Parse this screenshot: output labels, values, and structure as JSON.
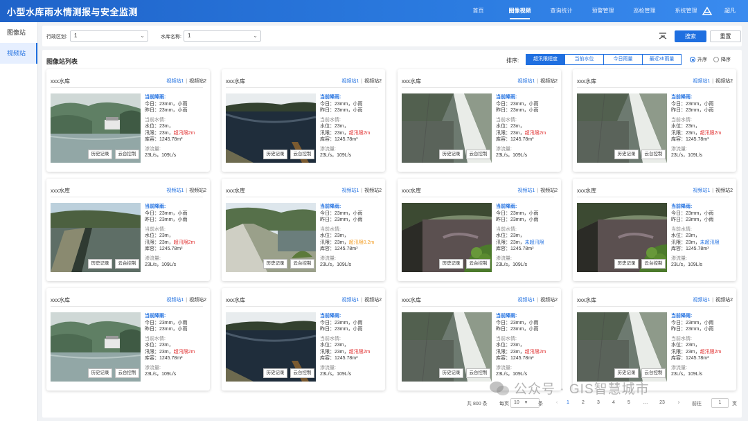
{
  "header": {
    "title": "小型水库雨水情测报与安全监测",
    "nav": [
      "首页",
      "图像视频",
      "查询统计",
      "预警管理",
      "巡检管理",
      "系统管理"
    ],
    "active_nav": 1,
    "user": "超凡",
    "colors": {
      "primary": "#1f6fe0",
      "header": "#2b7be0",
      "danger": "#e02c2c",
      "warning": "#f39b1e"
    }
  },
  "sidebar": {
    "items": [
      "图像站",
      "视频站"
    ],
    "active": 1
  },
  "filter": {
    "region_label": "行政区划:",
    "region_value": "1",
    "reservoir_label": "水库名称:",
    "reservoir_value": "1",
    "search_label": "搜索",
    "reset_label": "重置"
  },
  "list": {
    "title": "图像站列表",
    "sort_label": "排序:",
    "sort_options": [
      "超汛限程度",
      "当前水位",
      "今日雨量",
      "最近3h雨量"
    ],
    "sort_active": 0,
    "order_asc": "升序",
    "order_desc": "降序",
    "order_selected": "asc"
  },
  "cards": [
    {
      "name": "xxx水库",
      "link1": "视频站1",
      "link2": "视频站2",
      "rain_hd": "当前降雨:",
      "today": "今日：23mm，小雨",
      "yesterday": "昨日：23mm，小雨",
      "water_hd": "当前水情:",
      "level": "水位：23m，",
      "flood": "汛限：23m，",
      "flood_note": "超汛限2m",
      "flood_class": "red",
      "storage": "库容：1245.78m³",
      "seep_hd": "渗流量:",
      "seep": "23L/s，109L/s",
      "scene": 0
    },
    {
      "name": "xxx水库",
      "link1": "视频站1",
      "link2": "视频站2",
      "rain_hd": "当前降雨:",
      "today": "今日：23mm，小雨",
      "yesterday": "昨日：23mm，小雨",
      "water_hd": "当前水情:",
      "level": "水位：23m，",
      "flood": "汛限：23m，",
      "flood_note": "超汛限2m",
      "flood_class": "red",
      "storage": "库容：1245.78m³",
      "seep_hd": "渗流量:",
      "seep": "23L/s，109L/s",
      "scene": 1
    },
    {
      "name": "xxx水库",
      "link1": "视频站1",
      "link2": "视频站2",
      "rain_hd": "当前降雨:",
      "today": "今日：23mm，小雨",
      "yesterday": "昨日：23mm，小雨",
      "water_hd": "当前水情:",
      "level": "水位：23m，",
      "flood": "汛限：23m，",
      "flood_note": "超汛限2m",
      "flood_class": "red",
      "storage": "库容：1245.78m³",
      "seep_hd": "渗流量:",
      "seep": "23L/s，109L/s",
      "scene": 2
    },
    {
      "name": "xxx水库",
      "link1": "视频站1",
      "link2": "视频站2",
      "rain_hd": "当前降雨:",
      "today": "今日：23mm，小雨",
      "yesterday": "昨日：23mm，小雨",
      "water_hd": "当前水情:",
      "level": "水位：23m，",
      "flood": "汛限：23m，",
      "flood_note": "超汛限2m",
      "flood_class": "red",
      "storage": "库容：1245.78m³",
      "seep_hd": "渗流量:",
      "seep": "23L/s，109L/s",
      "scene": 2
    },
    {
      "name": "xxx水库",
      "link1": "视频站1",
      "link2": "视频站2",
      "rain_hd": "当前降雨:",
      "today": "今日：23mm，小雨",
      "yesterday": "昨日：23mm，小雨",
      "water_hd": "当前水情:",
      "level": "水位：23m，",
      "flood": "汛限：23m，",
      "flood_note": "超汛限2m",
      "flood_class": "red",
      "storage": "库容：1245.78m³",
      "seep_hd": "渗流量:",
      "seep": "23L/s，109L/s",
      "scene": 3
    },
    {
      "name": "xxx水库",
      "link1": "视频站1",
      "link2": "视频站2",
      "rain_hd": "当前降雨:",
      "today": "今日：23mm，小雨",
      "yesterday": "昨日：23mm，小雨",
      "water_hd": "当前水情:",
      "level": "水位：23m，",
      "flood": "汛限：23m，",
      "flood_note": "超汛限0.2m",
      "flood_class": "orange",
      "storage": "库容：1245.78m³",
      "seep_hd": "渗流量:",
      "seep": "23L/s，109L/s",
      "scene": 4
    },
    {
      "name": "xxx水库",
      "link1": "视频站1",
      "link2": "视频站2",
      "rain_hd": "当前降雨:",
      "today": "今日：23mm，小雨",
      "yesterday": "昨日：23mm，小雨",
      "water_hd": "当前水情:",
      "level": "水位：23m，",
      "flood": "汛限：23m，",
      "flood_note": "未超汛限",
      "flood_class": "blue",
      "storage": "库容：1245.78m³",
      "seep_hd": "渗流量:",
      "seep": "23L/s，109L/s",
      "scene": 5
    },
    {
      "name": "xxx水库",
      "link1": "视频站1",
      "link2": "视频站2",
      "rain_hd": "当前降雨:",
      "today": "今日：23mm，小雨",
      "yesterday": "昨日：23mm，小雨",
      "water_hd": "当前水情:",
      "level": "水位：23m，",
      "flood": "汛限：23m，",
      "flood_note": "未超汛限",
      "flood_class": "blue",
      "storage": "库容：1245.78m³",
      "seep_hd": "渗流量:",
      "seep": "23L/s，109L/s",
      "scene": 5
    },
    {
      "name": "xxx水库",
      "link1": "视频站1",
      "link2": "视频站2",
      "rain_hd": "当前降雨:",
      "today": "今日：23mm，小雨",
      "yesterday": "昨日：23mm，小雨",
      "water_hd": "当前水情:",
      "level": "水位：23m，",
      "flood": "汛限：23m，",
      "flood_note": "超汛限2m",
      "flood_class": "red",
      "storage": "库容：1245.78m³",
      "seep_hd": "渗流量:",
      "seep": "23L/s，109L/s",
      "scene": 0
    },
    {
      "name": "xxx水库",
      "link1": "视频站1",
      "link2": "视频站2",
      "rain_hd": "当前降雨:",
      "today": "今日：23mm，小雨",
      "yesterday": "昨日：23mm，小雨",
      "water_hd": "当前水情:",
      "level": "水位：23m，",
      "flood": "汛限：23m，",
      "flood_note": "超汛限2m",
      "flood_class": "red",
      "storage": "库容：1245.78m³",
      "seep_hd": "渗流量:",
      "seep": "23L/s，109L/s",
      "scene": 1
    },
    {
      "name": "xxx水库",
      "link1": "视频站1",
      "link2": "视频站2",
      "rain_hd": "当前降雨:",
      "today": "今日：23mm，小雨",
      "yesterday": "昨日：23mm，小雨",
      "water_hd": "当前水情:",
      "level": "水位：23m，",
      "flood": "汛限：23m，",
      "flood_note": "超汛限2m",
      "flood_class": "red",
      "storage": "库容：1245.78m³",
      "seep_hd": "渗流量:",
      "seep": "23L/s，109L/s",
      "scene": 2
    },
    {
      "name": "xxx水库",
      "link1": "视频站1",
      "link2": "视频站2",
      "rain_hd": "当前降雨:",
      "today": "今日：23mm，小雨",
      "yesterday": "昨日：23mm，小雨",
      "water_hd": "当前水情:",
      "level": "水位：23m，",
      "flood": "汛限：23m，",
      "flood_note": "超汛限2m",
      "flood_class": "red",
      "storage": "库容：1245.78m³",
      "seep_hd": "渗流量:",
      "seep": "23L/s，109L/s",
      "scene": 2
    }
  ],
  "card_buttons": {
    "history": "历史记录",
    "ptz": "云台控制"
  },
  "pager": {
    "total": "共 800 条",
    "per_page_label": "每页",
    "per_page": "10",
    "per_page_unit": "条",
    "pages": [
      "1",
      "2",
      "3",
      "4",
      "5",
      "…",
      "23"
    ],
    "goto_label": "前往",
    "goto_value": "1",
    "goto_unit": "页"
  },
  "watermark": "公众号 · GIS智慧城市"
}
